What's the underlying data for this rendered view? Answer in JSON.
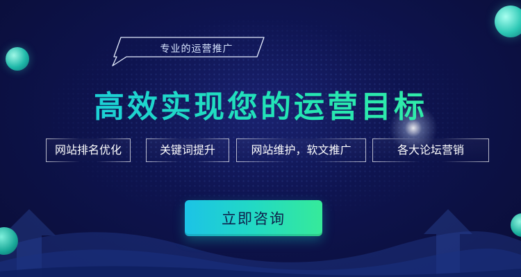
{
  "badge": {
    "text": "专业的运营推广"
  },
  "headline": {
    "text": "高效实现您的运营目标"
  },
  "tags": [
    {
      "label": "网站排名优化"
    },
    {
      "label": "关键词提升"
    },
    {
      "label": "网站维护，软文推广"
    },
    {
      "label": "各大论坛营销"
    }
  ],
  "cta": {
    "label": "立即咨询"
  },
  "colors": {
    "background": "#0e1450",
    "accent_start": "#1cc3e6",
    "accent_end": "#36ea9a",
    "text": "#ffffff"
  }
}
